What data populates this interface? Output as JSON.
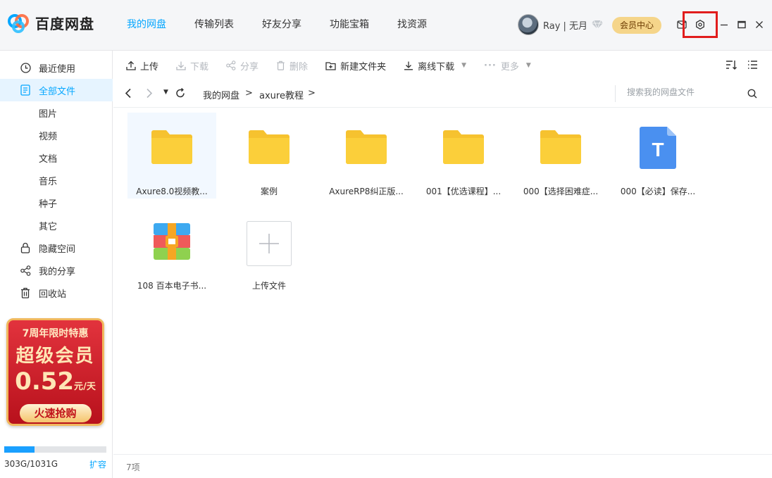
{
  "app": {
    "name": "百度网盘",
    "accent": "#06a7ff"
  },
  "nav": {
    "tabs": [
      "我的网盘",
      "传输列表",
      "好友分享",
      "功能宝箱",
      "找资源"
    ]
  },
  "user": {
    "name": "Ray | 无月",
    "vip_button": "会员中心"
  },
  "sidebar": {
    "items": [
      {
        "label": "最近使用",
        "icon": "clock-icon"
      },
      {
        "label": "全部文件",
        "icon": "document-icon"
      },
      {
        "label": "图片"
      },
      {
        "label": "视频"
      },
      {
        "label": "文档"
      },
      {
        "label": "音乐"
      },
      {
        "label": "种子"
      },
      {
        "label": "其它"
      },
      {
        "label": "隐藏空间",
        "icon": "lock-icon"
      },
      {
        "label": "我的分享",
        "icon": "share-icon"
      },
      {
        "label": "回收站",
        "icon": "trash-icon"
      }
    ],
    "promo": {
      "line1": "7周年限时特惠",
      "line2": "超级会员",
      "price": "0.52",
      "unit_top": "元",
      "unit_bottom": "天",
      "button": "火速抢购"
    },
    "storage": {
      "text": "303G/1031G",
      "used_fraction": 0.294,
      "expand": "扩容"
    }
  },
  "toolbar": {
    "upload": "上传",
    "download": "下载",
    "share": "分享",
    "delete": "删除",
    "new_folder": "新建文件夹",
    "offline_download": "离线下载",
    "more": "更多"
  },
  "path": {
    "crumbs": [
      "我的网盘",
      "axure教程"
    ],
    "separator": ">",
    "search_placeholder": "搜索我的网盘文件"
  },
  "files": [
    {
      "name": "Axure8.0视频教...",
      "type": "folder"
    },
    {
      "name": "案例",
      "type": "folder"
    },
    {
      "name": "AxureRP8纠正版...",
      "type": "folder"
    },
    {
      "name": "001【优选课程】...",
      "type": "folder"
    },
    {
      "name": "000【选择困难症...",
      "type": "folder"
    },
    {
      "name": "000【必读】保存...",
      "type": "text-doc",
      "glyph": "T"
    },
    {
      "name": "108 百本电子书...",
      "type": "archive"
    },
    {
      "name": "上传文件",
      "type": "upload-tile"
    }
  ],
  "status": {
    "count": "7项"
  }
}
